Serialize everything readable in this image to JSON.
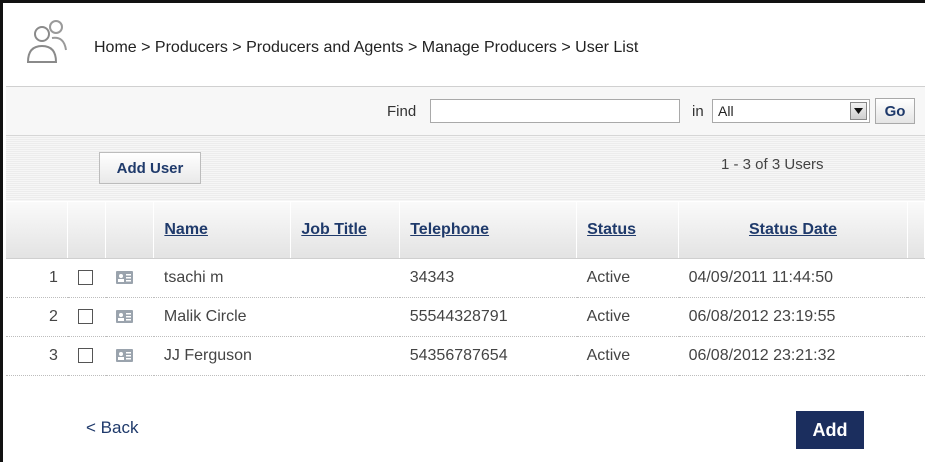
{
  "breadcrumb": "Home > Producers > Producers and Agents > Manage Producers > User List",
  "search": {
    "find_label": "Find",
    "value": "",
    "in_label": "in",
    "scope_selected": "All",
    "go_label": "Go"
  },
  "toolbar": {
    "add_user_label": "Add User",
    "count_text": "1 - 3 of 3 Users"
  },
  "table": {
    "columns": [
      "Name",
      "Job Title",
      "Telephone",
      "Status",
      "Status Date"
    ],
    "rows": [
      {
        "num": "1",
        "name": "tsachi m",
        "job_title": "",
        "telephone": "34343",
        "status": "Active",
        "status_date": "04/09/2011 11:44:50"
      },
      {
        "num": "2",
        "name": "Malik Circle",
        "job_title": "",
        "telephone": "55544328791",
        "status": "Active",
        "status_date": "06/08/2012 23:19:55"
      },
      {
        "num": "3",
        "name": "JJ Ferguson",
        "job_title": "",
        "telephone": "54356787654",
        "status": "Active",
        "status_date": "06/08/2012 23:21:32"
      }
    ]
  },
  "footer": {
    "back_label": "< Back",
    "add_label": "Add"
  },
  "icons": {
    "header": "users-group-icon",
    "select_arrow": "chevron-down-icon",
    "row": "contact-card-icon"
  },
  "colors": {
    "link": "#1f3a6b",
    "add_button": "#1b2e5e"
  }
}
